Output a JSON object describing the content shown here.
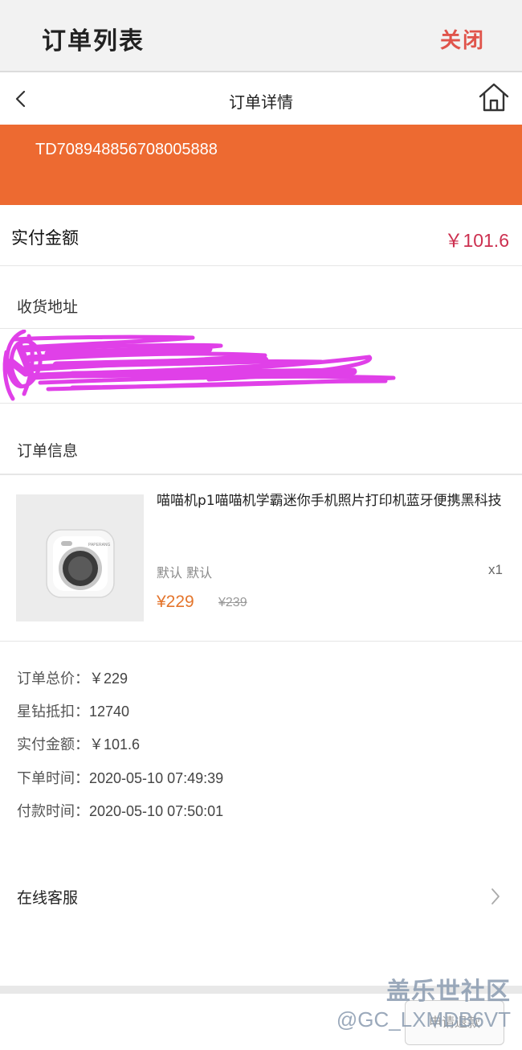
{
  "topbar": {
    "title": "订单列表",
    "close_label": "关闭"
  },
  "navbar": {
    "title": "订单详情"
  },
  "order": {
    "number": "TD708948856708005888"
  },
  "paid": {
    "label": "实付金额",
    "amount": "￥101.6"
  },
  "address": {
    "header": "收货地址"
  },
  "order_info": {
    "header": "订单信息"
  },
  "product": {
    "name": "喵喵机p1喵喵机学霸迷你手机照片打印机蓝牙便携黑科技",
    "spec": "默认 默认",
    "qty": "x1",
    "price": "¥229",
    "original_price": "¥239",
    "image_label": "PAPERANG"
  },
  "summary": [
    {
      "label": "订单总价：",
      "value": "￥229"
    },
    {
      "label": "星钻抵扣：",
      "value": "12740"
    },
    {
      "label": "实付金额：",
      "value": "￥101.6"
    },
    {
      "label": "下单时间：",
      "value": "2020-05-10 07:49:39"
    },
    {
      "label": "付款时间：",
      "value": "2020-05-10 07:50:01"
    }
  ],
  "customer_service": {
    "label": "在线客服"
  },
  "bottom": {
    "button_label": "申请退款"
  },
  "watermark": {
    "line1": "盖乐世社区",
    "line2": "@GC_LXMDB6VT"
  },
  "colors": {
    "banner": "#ed6a31",
    "close": "#e0544b",
    "amount": "#cc2f4f",
    "price": "#e4752c",
    "scribble": "#e040e8"
  }
}
